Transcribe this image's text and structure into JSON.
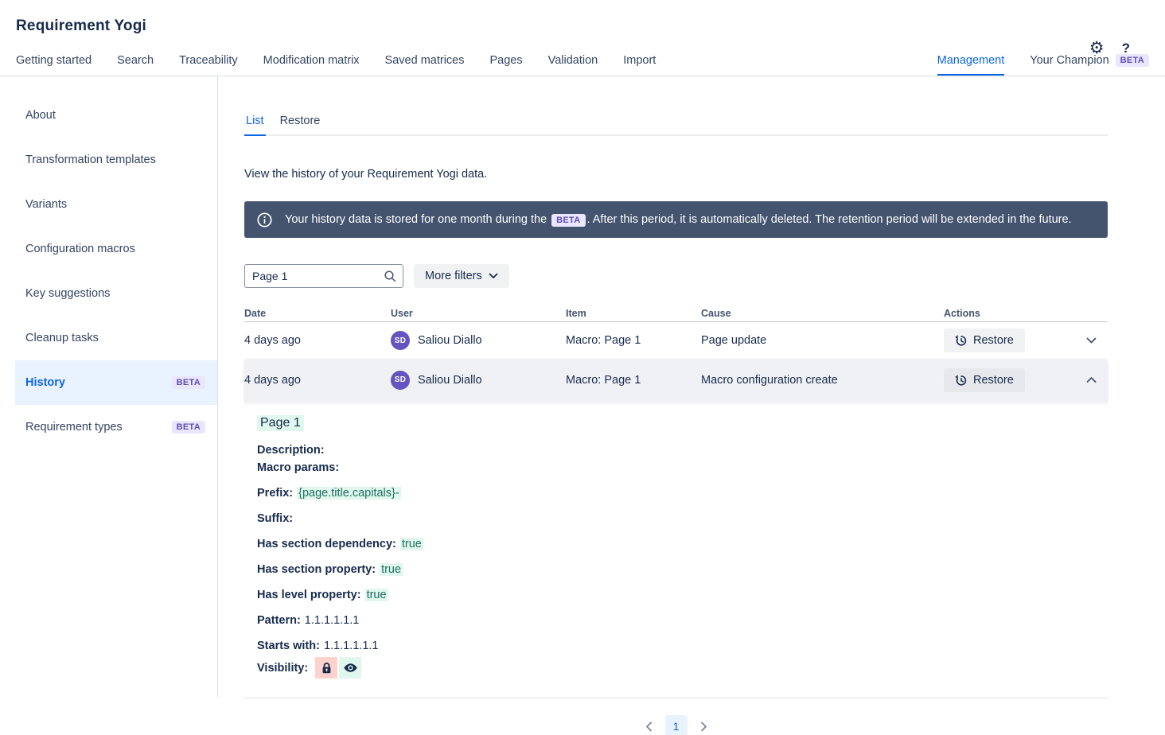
{
  "header": {
    "title": "Requirement Yogi",
    "settings_glyph": "⚙",
    "help_glyph": "?"
  },
  "nav": {
    "items": [
      "Getting started",
      "Search",
      "Traceability",
      "Modification matrix",
      "Saved matrices",
      "Pages",
      "Validation",
      "Import"
    ],
    "management": "Management",
    "champion": "Your Champion",
    "champion_badge": "BETA"
  },
  "sidebar": {
    "items": [
      {
        "label": "About"
      },
      {
        "label": "Transformation templates"
      },
      {
        "label": "Variants"
      },
      {
        "label": "Configuration macros"
      },
      {
        "label": "Key suggestions"
      },
      {
        "label": "Cleanup tasks"
      },
      {
        "label": "History",
        "beta": "BETA",
        "active": true
      },
      {
        "label": "Requirement types",
        "beta": "BETA"
      }
    ]
  },
  "main": {
    "tabs": [
      {
        "label": "List",
        "active": true
      },
      {
        "label": "Restore"
      }
    ],
    "intro": "View the history of your Requirement Yogi data.",
    "banner": {
      "text_before": "Your history data is stored for one month during the",
      "badge": "BETA",
      "text_after": ". After this period, it is automatically deleted. The retention period will be extended in the future."
    },
    "filters": {
      "search_value": "Page 1",
      "more_filters_label": "More filters"
    },
    "table": {
      "headers": {
        "date": "Date",
        "user": "User",
        "item": "Item",
        "cause": "Cause",
        "actions": "Actions"
      },
      "rows": [
        {
          "date": "4 days ago",
          "user_initials": "SD",
          "user": "Saliou Diallo",
          "item": "Macro: Page 1",
          "cause": "Page update",
          "action_label": "Restore",
          "expanded": false
        },
        {
          "date": "4 days ago",
          "user_initials": "SD",
          "user": "Saliou Diallo",
          "item": "Macro: Page 1",
          "cause": "Macro configuration create",
          "action_label": "Restore",
          "expanded": true
        }
      ]
    },
    "detail": {
      "title": "Page 1",
      "fields": [
        {
          "label": "Description:",
          "value": ""
        },
        {
          "label": "Macro params:",
          "value": ""
        },
        {
          "label": "Prefix:",
          "value": "{page.title.capitals}-",
          "highlight": true
        },
        {
          "label": "Suffix:",
          "value": ""
        },
        {
          "label": "Has section dependency:",
          "value": "true",
          "highlight": true
        },
        {
          "label": "Has section property:",
          "value": "true",
          "highlight": true
        },
        {
          "label": "Has level property:",
          "value": "true",
          "highlight": true
        },
        {
          "label": "Pattern:",
          "value": "1.1.1.1.1.1"
        },
        {
          "label": "Starts with:",
          "value": "1.1.1.1.1.1"
        },
        {
          "label": "Visibility:",
          "icons": [
            "lock-icon",
            "eye-icon"
          ]
        }
      ]
    },
    "pagination": {
      "current": "1"
    }
  },
  "colors": {
    "accent_blue": "#0C66E4",
    "banner_bg": "#44546F",
    "beta_badge_bg": "#EAE6FF",
    "beta_badge_text": "#5E4DB2",
    "highlight_mint": "#DFF7EC",
    "highlight_text": "#216E63",
    "avatar_purple": "#6554C0",
    "lock_chip_pink": "#FFD2CC",
    "sidebar_active_bg": "#E9F2FF",
    "text_primary": "#172B4D"
  }
}
